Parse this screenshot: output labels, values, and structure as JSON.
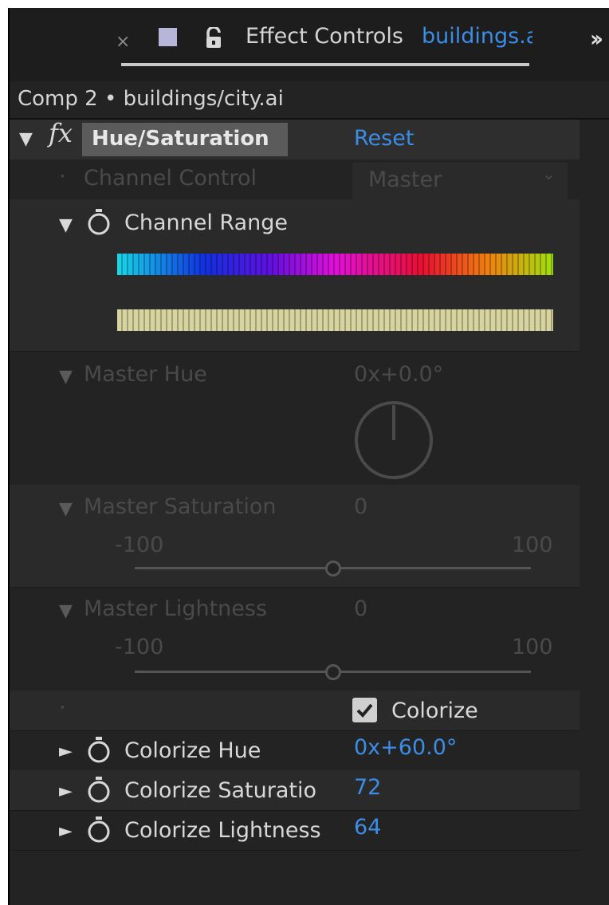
{
  "tab": {
    "close_glyph": "×",
    "title": "Effect Controls",
    "layer_link": "buildings.ai",
    "more_glyph": "››",
    "swatch_color": "#b8b6d8"
  },
  "breadcrumb": {
    "text": "Comp 2 • buildings/city.ai"
  },
  "effect": {
    "fx_glyph": "fx",
    "name": "Hue/Saturation",
    "reset_label": "Reset"
  },
  "params": {
    "channel_control": {
      "label": "Channel Control",
      "value": "Master",
      "bullet": "·"
    },
    "channel_range": {
      "label": "Channel Range"
    },
    "master_hue": {
      "label": "Master Hue",
      "value": "0x+0.0°"
    },
    "master_saturation": {
      "label": "Master Saturation",
      "value": "0",
      "min": "-100",
      "max": "100",
      "level": 0.5
    },
    "master_lightness": {
      "label": "Master Lightness",
      "value": "0",
      "min": "-100",
      "max": "100",
      "level": 0.5
    },
    "colorize": {
      "label": "Colorize",
      "checked": true
    },
    "colorize_hue": {
      "label": "Colorize Hue",
      "value": "0x+60.0°"
    },
    "colorize_saturation": {
      "label": "Colorize Saturatio",
      "value": "72"
    },
    "colorize_lightness": {
      "label": "Colorize Lightness",
      "value": "64"
    }
  },
  "colors": {
    "accent_blue": "#3b8de6",
    "panel_bg": "#232323",
    "range_bar": "#d8d4a0"
  }
}
